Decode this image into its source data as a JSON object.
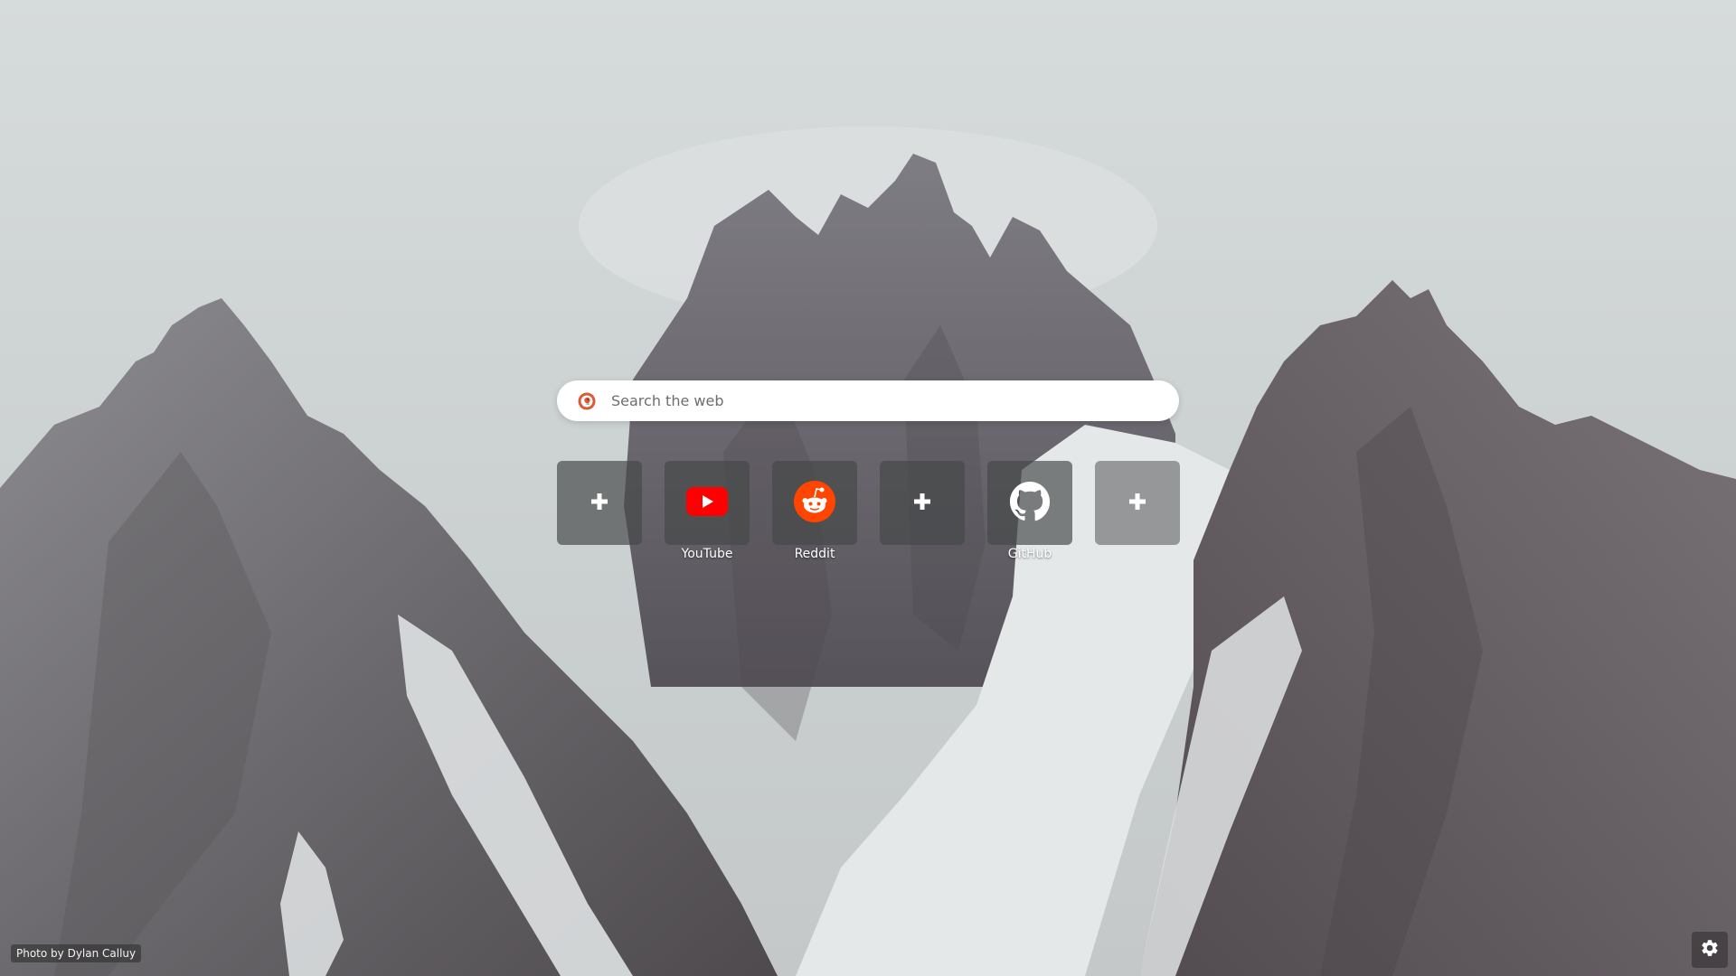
{
  "search": {
    "placeholder": "Search the web",
    "engine_icon": "duckduckgo-icon"
  },
  "shortcuts": [
    {
      "label": "",
      "icon": "plus-icon"
    },
    {
      "label": "YouTube",
      "icon": "youtube-icon"
    },
    {
      "label": "Reddit",
      "icon": "reddit-icon"
    },
    {
      "label": "",
      "icon": "plus-icon"
    },
    {
      "label": "GitHub",
      "icon": "github-icon"
    },
    {
      "label": "",
      "icon": "plus-icon"
    }
  ],
  "footer": {
    "photo_credit": "Photo by Dylan Calluy",
    "settings_icon": "gear-icon"
  },
  "colors": {
    "youtube": "#ff0000",
    "reddit": "#ff4500",
    "sky": "#d3d8d8",
    "rock": "#6f6c70",
    "snow": "#e6e9ea"
  }
}
